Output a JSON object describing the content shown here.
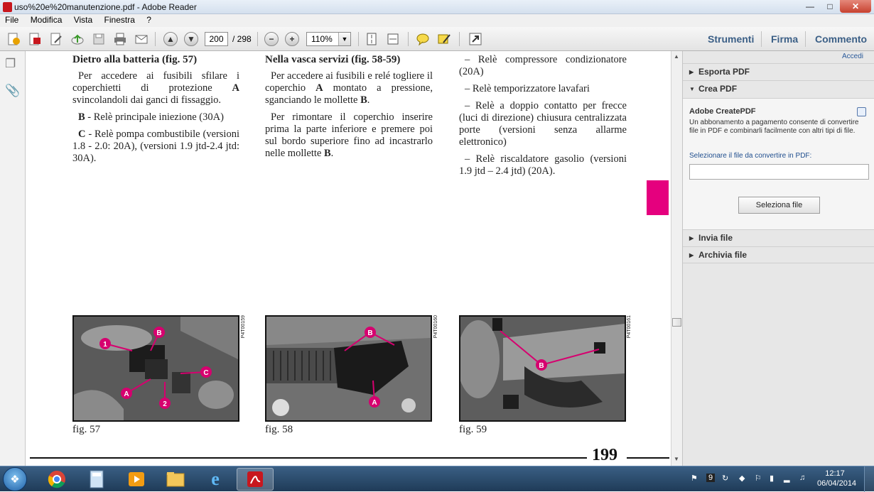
{
  "window": {
    "title": "uso%20e%20manutenzione.pdf - Adobe Reader"
  },
  "menu": [
    "File",
    "Modifica",
    "Vista",
    "Finestra",
    "?"
  ],
  "toolbar": {
    "page_current": "200",
    "page_total": "/ 298",
    "zoom": "110%",
    "tab_tools": "Strumenti",
    "tab_sign": "Firma",
    "tab_comment": "Commento"
  },
  "document": {
    "col1": {
      "heading": "Dietro alla batteria (fig. 57)",
      "p1_pre": "Per accedere ai fusibili sfilare i coperchietti di protezione ",
      "p1_bold": "A",
      "p1_post": " svincolandoli dai ganci di fissaggio.",
      "p2_bold": "B",
      "p2_post": " - Relè principale iniezione (30A)",
      "p3_bold": "C",
      "p3_post": " - Relè pompa combustibile (versioni 1.8 - 2.0: 20A), (versioni 1.9 jtd-2.4 jtd: 30A)."
    },
    "col2": {
      "heading": "Nella vasca servizi (fig. 58-59)",
      "p1_pre": "Per accedere ai fusibili e relé togliere il coperchio ",
      "p1_bold": "A",
      "p1_mid": " montato a pressione, sganciando le mollette ",
      "p1_bold2": "B",
      "p1_end": ".",
      "p2_pre": "Per rimontare il coperchio inserire prima la parte inferiore e premere poi sul bordo superiore fino ad incastrarlo nelle mollette ",
      "p2_bold": "B",
      "p2_end": "."
    },
    "col3": {
      "items": [
        "– Relè compressore condizionatore (20A)",
        "– Relè temporizzatore lavafari",
        "– Relè a doppio contatto per frecce (luci di direzione) chiusura centralizzata porte (versioni senza allarme elettronico)",
        "– Relè riscaldatore gasolio (versioni 1.9 jtd – 2.4 jtd) (20A)."
      ]
    },
    "figures": [
      {
        "caption": "fig. 57",
        "code": "P4T00159",
        "labels": [
          "1",
          "B",
          "A",
          "2",
          "C"
        ]
      },
      {
        "caption": "fig. 58",
        "code": "P4T00160",
        "labels": [
          "B",
          "A"
        ]
      },
      {
        "caption": "fig. 59",
        "code": "P4T00161",
        "labels": [
          "B"
        ]
      }
    ],
    "page_number": "199",
    "tab_color": "#e5007e"
  },
  "right_panel": {
    "accedi": "Accedi",
    "sections": {
      "export": "Esporta PDF",
      "create": "Crea PDF",
      "send": "Invia file",
      "archive": "Archivia file"
    },
    "create_panel": {
      "title": "Adobe CreatePDF",
      "description": "Un abbonamento a pagamento consente di convertire file in PDF e combinarli facilmente con altri tipi di file.",
      "label": "Selezionare il file da convertire in PDF:",
      "button": "Seleziona file"
    }
  },
  "taskbar": {
    "time": "12:17",
    "date": "06/04/2014",
    "tray_count": "9"
  }
}
